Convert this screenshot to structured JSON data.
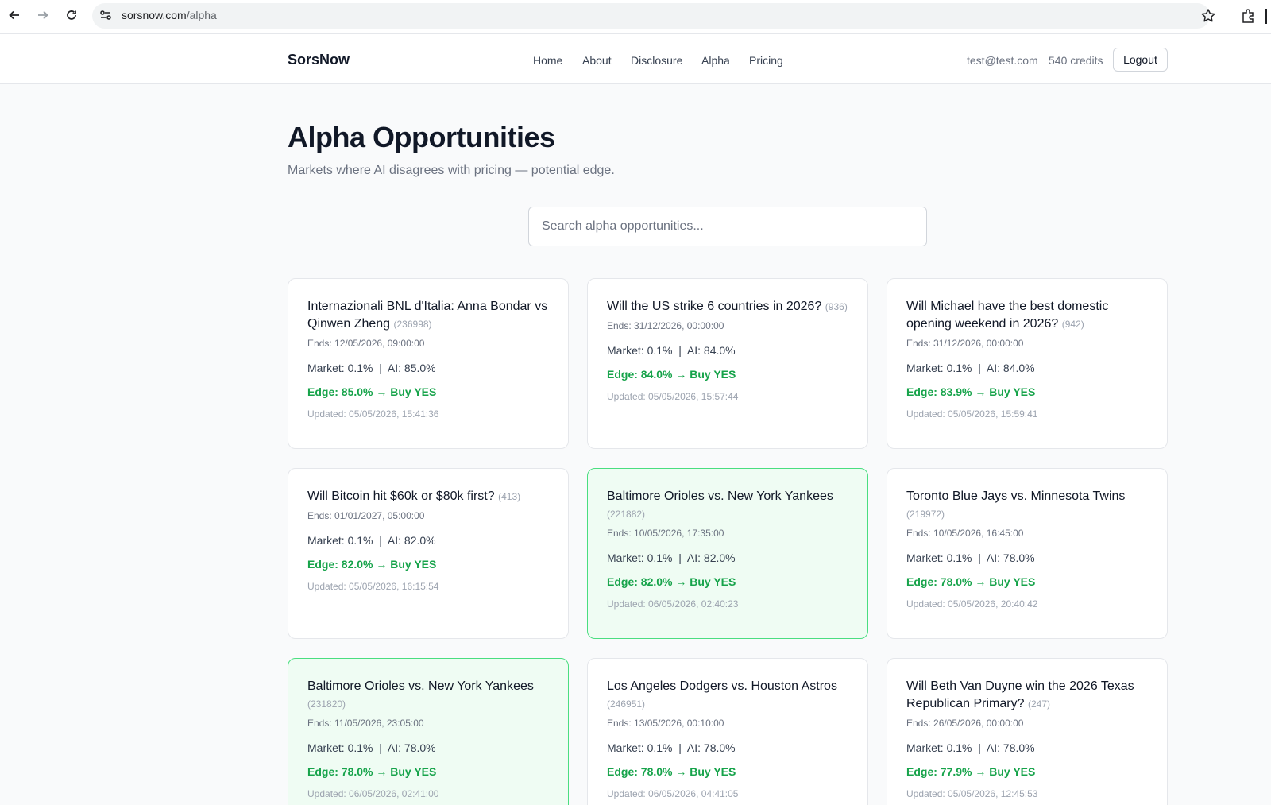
{
  "browser": {
    "url_host": "sorsnow.com",
    "url_path": "/alpha"
  },
  "header": {
    "brand": "SorsNow",
    "nav": [
      "Home",
      "About",
      "Disclosure",
      "Alpha",
      "Pricing"
    ],
    "user_email": "test@test.com",
    "credits": "540 credits",
    "logout_label": "Logout"
  },
  "main": {
    "title": "Alpha Opportunities",
    "subtitle": "Markets where AI disagrees with pricing — potential edge.",
    "search_placeholder": "Search alpha opportunities..."
  },
  "cards": [
    {
      "title": "Internazionali BNL d'Italia: Anna Bondar vs Qinwen Zheng",
      "id": "(236998)",
      "ends": "Ends: 12/05/2026, 09:00:00",
      "market": "Market: 0.1%  |  AI: 85.0%",
      "edge": "Edge: 85.0% → Buy YES",
      "updated": "Updated: 05/05/2026, 15:41:36",
      "highlight": false
    },
    {
      "title": "Will the US strike 6 countries in 2026?",
      "id": "(936)",
      "ends": "Ends: 31/12/2026, 00:00:00",
      "market": "Market: 0.1%  |  AI: 84.0%",
      "edge": "Edge: 84.0% → Buy YES",
      "updated": "Updated: 05/05/2026, 15:57:44",
      "highlight": false
    },
    {
      "title": "Will Michael have the best domestic opening weekend in 2026?",
      "id": "(942)",
      "ends": "Ends: 31/12/2026, 00:00:00",
      "market": "Market: 0.1%  |  AI: 84.0%",
      "edge": "Edge: 83.9% → Buy YES",
      "updated": "Updated: 05/05/2026, 15:59:41",
      "highlight": false
    },
    {
      "title": "Will Bitcoin hit $60k or $80k first?",
      "id": "(413)",
      "ends": "Ends: 01/01/2027, 05:00:00",
      "market": "Market: 0.1%  |  AI: 82.0%",
      "edge": "Edge: 82.0% → Buy YES",
      "updated": "Updated: 05/05/2026, 16:15:54",
      "highlight": false
    },
    {
      "title": "Baltimore Orioles vs. New York Yankees",
      "id": "(221882)",
      "ends": "Ends: 10/05/2026, 17:35:00",
      "market": "Market: 0.1%  |  AI: 82.0%",
      "edge": "Edge: 82.0% → Buy YES",
      "updated": "Updated: 06/05/2026, 02:40:23",
      "highlight": true
    },
    {
      "title": "Toronto Blue Jays vs. Minnesota Twins",
      "id": "(219972)",
      "ends": "Ends: 10/05/2026, 16:45:00",
      "market": "Market: 0.1%  |  AI: 78.0%",
      "edge": "Edge: 78.0% → Buy YES",
      "updated": "Updated: 05/05/2026, 20:40:42",
      "highlight": false
    },
    {
      "title": "Baltimore Orioles vs. New York Yankees",
      "id": "(231820)",
      "ends": "Ends: 11/05/2026, 23:05:00",
      "market": "Market: 0.1%  |  AI: 78.0%",
      "edge": "Edge: 78.0% → Buy YES",
      "updated": "Updated: 06/05/2026, 02:41:00",
      "highlight": true
    },
    {
      "title": "Los Angeles Dodgers vs. Houston Astros",
      "id": "(246951)",
      "ends": "Ends: 13/05/2026, 00:10:00",
      "market": "Market: 0.1%  |  AI: 78.0%",
      "edge": "Edge: 78.0% → Buy YES",
      "updated": "Updated: 06/05/2026, 04:41:05",
      "highlight": false
    },
    {
      "title": "Will Beth Van Duyne win the 2026 Texas Republican Primary?",
      "id": "(247)",
      "ends": "Ends: 26/05/2026, 00:00:00",
      "market": "Market: 0.1%  |  AI: 78.0%",
      "edge": "Edge: 77.9% → Buy YES",
      "updated": "Updated: 05/05/2026, 12:45:53",
      "highlight": false
    }
  ]
}
